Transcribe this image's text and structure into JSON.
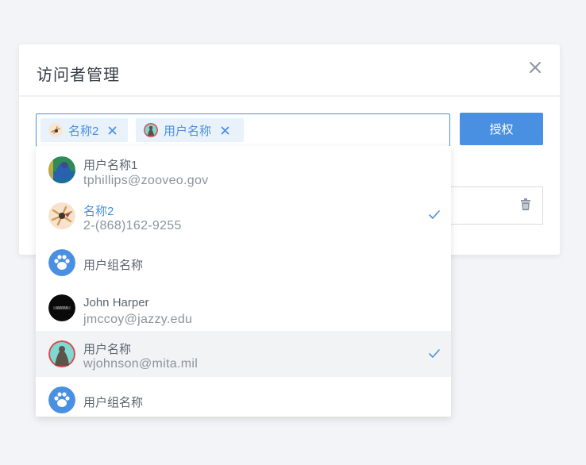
{
  "modal": {
    "title": "访问者管理",
    "authorize_label": "授权"
  },
  "selected_tags": [
    {
      "label": "名称2"
    },
    {
      "label": "用户名称"
    }
  ],
  "dropdown": {
    "items": [
      {
        "name": "用户名称1",
        "sub": "tphillips@zooveo.gov",
        "selected": false
      },
      {
        "name": "名称2",
        "sub": "2-(868)162-9255",
        "selected": true
      },
      {
        "name": "用户组名称",
        "sub": "",
        "selected": false
      },
      {
        "name": "John Harper",
        "sub": "jmccoy@jazzy.edu",
        "selected": false
      },
      {
        "name": "用户名称",
        "sub": "wjohnson@mita.mil",
        "selected": true
      },
      {
        "name": "用户组名称",
        "sub": "",
        "selected": false
      }
    ]
  },
  "colors": {
    "accent": "#4a90e2",
    "tag_bg": "#e9f1fb",
    "hover_row": "#f2f3f5"
  },
  "icons": {
    "close": "close-icon",
    "tag_remove": "tag-close-icon",
    "trash": "trash-icon",
    "check": "check-icon",
    "group": "paw-group-icon"
  }
}
